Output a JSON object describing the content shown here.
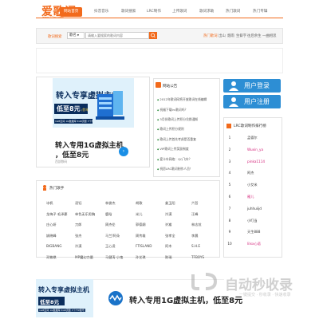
{
  "logo": {
    "name": "爱歌词",
    "url": "www.22lrc.com"
  },
  "nav": [
    {
      "label": "网站首页",
      "active": true
    },
    {
      "label": "抖音音乐",
      "active": false
    },
    {
      "label": "歌词搜索",
      "active": false
    },
    {
      "label": "LRC制作",
      "active": false
    },
    {
      "label": "上传歌词",
      "active": false
    },
    {
      "label": "歌词求助",
      "active": false
    },
    {
      "label": "热门歌词",
      "active": false
    },
    {
      "label": "热门专辑",
      "active": false
    }
  ],
  "search": {
    "label": "歌词搜索",
    "select_value": "歌名",
    "placeholder": "请输入要搜索的歌词内容",
    "hot_label": "热门歌词",
    "hot_items": [
      "出山",
      "烟雨",
      "生僻字",
      "往后余生",
      "一曲相思"
    ]
  },
  "ad": {
    "title": "转入专享虚拟主机",
    "price": "低至8元",
    "price_unit": "/首年",
    "note": "1GB空间 1G数据库 5GB流量 3个FTP账号",
    "headline_1": "转入专用1G虚拟主机",
    "headline_2": "，低至8元",
    "source": "西部数码",
    "arrow": "›"
  },
  "notice": {
    "title": "网站公告",
    "items": [
      "2012年歌词网将开放歌词在线编辑",
      "祝福下载lrc歌词吗？",
      "3月份歌词上传积分兑换通知",
      "歌词上传积分规则",
      "歌词上传首先考虑是否重复",
      "VIP歌词上传奖励制度",
      "爱卡车网络：QQ飞车？",
      "祝愿LRC歌词制作人员！"
    ]
  },
  "user": {
    "login": "用户登录",
    "register": "用户注册"
  },
  "ranking": {
    "title": "LRC歌词制作排行榜",
    "items": [
      {
        "num": "1",
        "name": "孟德尔",
        "color": "#333333"
      },
      {
        "num": "2",
        "name": "Wuxin_ya",
        "color": "#d4237a"
      },
      {
        "num": "3",
        "name": "pinka1114",
        "color": "#d4237a"
      },
      {
        "num": "4",
        "name": "阿杰",
        "color": "#333333"
      },
      {
        "num": "5",
        "name": "小艾米",
        "color": "#333333"
      },
      {
        "num": "6",
        "name": "雁儿",
        "color": "#d4237a"
      },
      {
        "num": "7",
        "name": "juhhuiijd",
        "color": "#333333"
      },
      {
        "num": "8",
        "name": "小叮当",
        "color": "#333333"
      },
      {
        "num": "9",
        "name": "天生888",
        "color": "#333333"
      },
      {
        "num": "10",
        "name": "lilxx心语",
        "color": "#d4237a"
      }
    ]
  },
  "singers": {
    "title": "热门歌手",
    "rows": [
      [
        "冰帆",
        "凌钰",
        "林俊杰",
        "胡歌",
        "姜玉阳",
        "六哲"
      ],
      [
        "龙梅子 毛泽豪",
        "单色无乐男胸",
        "鹿晗",
        "米儿",
        "冷漠",
        "汪峰"
      ],
      [
        "庄心妍",
        "刀郎",
        "周杰伦",
        "郭德纲",
        "许嵩",
        "林志炫"
      ],
      [
        "姚晓峰",
        "张杰",
        "马兰/阿朵",
        "周传雄",
        "张孝全",
        "李晨"
      ],
      [
        "BIGBANG",
        "冷漠",
        "王心凌",
        "FTISLAND",
        "阿木",
        "S.H.E"
      ],
      [
        "邓紫棋",
        "MP魔幻力量",
        "马健涛 小鬼",
        "孙艺琪",
        "陈瑞",
        "TFBOYS"
      ]
    ]
  },
  "watermark": {
    "text": "自动秒收录",
    "sub": "一键提交 · 秒收录 · 快速收录"
  }
}
